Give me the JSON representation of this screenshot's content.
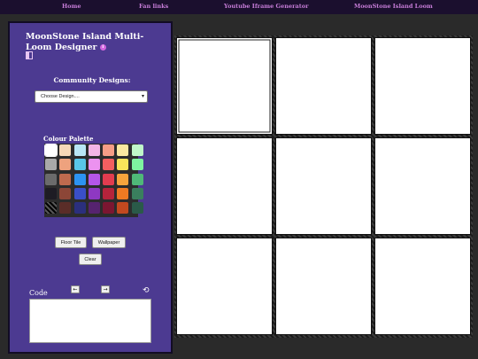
{
  "nav": [
    "Home",
    "Fan links",
    "Youtube Iframe Generator",
    "MoonStone Island Loom"
  ],
  "sidebar": {
    "title": "MoonStone Island Multi-Loom Designer",
    "info_icon": "info-icon",
    "book_icon": "book-icon",
    "community_label": "Community Designs:",
    "select_value": "Choose Design....",
    "palette_label": "Colour Palette",
    "palette_colors": [
      "#ffffff",
      "#f7d8b8",
      "#b9e6f5",
      "#f3b5e6",
      "#f69d86",
      "#fbe8a0",
      "#bff7c9",
      "#a9a9a9",
      "#eea27e",
      "#59c6e8",
      "#ec92f0",
      "#f25f60",
      "#f8e45a",
      "#7ef3a0",
      "#6b6b6b",
      "#bf6a4e",
      "#2c93f2",
      "#b456e8",
      "#e23c4f",
      "#f6a43c",
      "#4fb878",
      "#1e1c24",
      "#8c4637",
      "#3a4fc8",
      "#8e38c2",
      "#b5233b",
      "#ee7a22",
      "#3a7f5e",
      "#000000",
      "#5a2d28",
      "#2b2f7d",
      "#56236f",
      "#7b1631",
      "#c2491f",
      "#2a5a49"
    ],
    "buttons": {
      "floor_tile": "Floor Tile",
      "wallpaper": "Wallpaper",
      "clear": "Clear"
    },
    "code_label": "Code",
    "code_value": ""
  },
  "tiles": {
    "count": 9,
    "selected_index": 0
  }
}
